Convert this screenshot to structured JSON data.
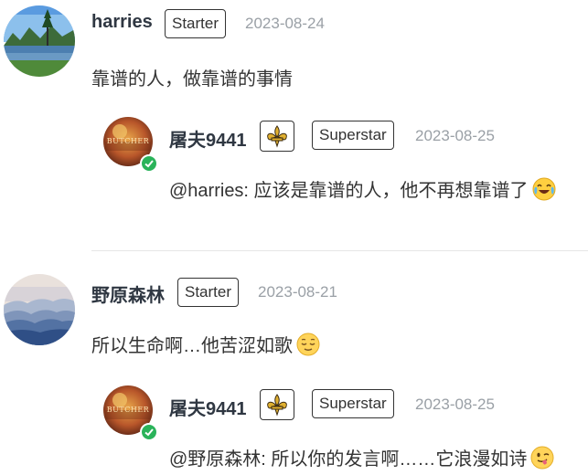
{
  "comments": [
    {
      "author": "harries",
      "role_badge": "Starter",
      "date": "2023-08-24",
      "text": "靠谱的人，做靠谱的事情",
      "avatar_icon": "lake-landscape-avatar",
      "reply": {
        "author": "屠夫9441",
        "level_icon": "fleur-de-lis-icon",
        "role_badge": "Superstar",
        "date": "2023-08-25",
        "text": "@harries: 应该是靠谱的人，他不再想靠谱了",
        "emoji": "crying-laughing-emoji",
        "avatar_label": "BUTCHER"
      }
    },
    {
      "author": "野原森林",
      "role_badge": "Starter",
      "date": "2023-08-21",
      "text": "所以生命啊…他苦涩如歌",
      "emoji": "relieved-face-emoji",
      "avatar_icon": "misty-mountains-avatar",
      "reply": {
        "author": "屠夫9441",
        "level_icon": "fleur-de-lis-icon",
        "role_badge": "Superstar",
        "date": "2023-08-25",
        "text": "@野原森林: 所以你的发言啊……它浪漫如诗",
        "emoji": "tongue-out-emoji",
        "avatar_label": "BUTCHER"
      }
    }
  ],
  "colors": {
    "name": "#2f3742",
    "date": "#9aa0a6",
    "verified": "#2ab35a",
    "divider": "#e6e6e6"
  }
}
